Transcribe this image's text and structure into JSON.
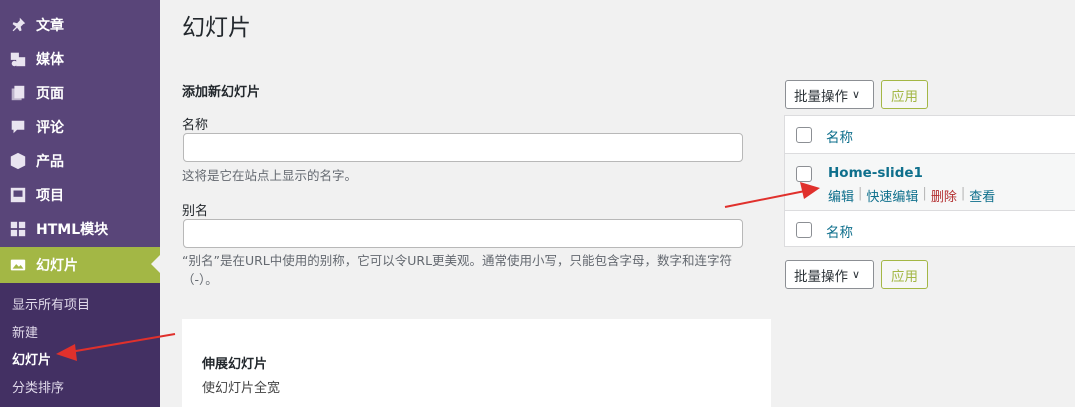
{
  "sidebar": {
    "items": [
      {
        "label": "文章",
        "icon": "pin-icon"
      },
      {
        "label": "媒体",
        "icon": "media-icon"
      },
      {
        "label": "页面",
        "icon": "pages-icon"
      },
      {
        "label": "评论",
        "icon": "comment-icon"
      },
      {
        "label": "产品",
        "icon": "cube-icon"
      },
      {
        "label": "项目",
        "icon": "portfolio-icon"
      },
      {
        "label": "HTML模块",
        "icon": "grid-icon"
      },
      {
        "label": "幻灯片",
        "icon": "slides-icon"
      }
    ],
    "submenu": [
      {
        "label": "显示所有项目"
      },
      {
        "label": "新建"
      },
      {
        "label": "幻灯片"
      },
      {
        "label": "分类排序"
      }
    ],
    "colors": {
      "background": "#594579",
      "active": "#a3b745",
      "submenu": "#433063"
    }
  },
  "page": {
    "title": "幻灯片"
  },
  "form": {
    "heading": "添加新幻灯片",
    "name_label": "名称",
    "name_value": "",
    "name_help": "这将是它在站点上显示的名字。",
    "slug_label": "别名",
    "slug_value": "",
    "slug_help": "“别名”是在URL中使用的别称，它可以令URL更美观。通常使用小写，只能包含字母，数字和连字符（-）。"
  },
  "extend": {
    "title": "伸展幻灯片",
    "desc": "使幻灯片全宽"
  },
  "list": {
    "bulk_label": "批量操作",
    "apply_label": "应用",
    "column_name": "名称",
    "rows": [
      {
        "title": "Home-slide1",
        "actions": {
          "edit": "编辑",
          "quick_edit": "快速编辑",
          "delete": "删除",
          "view": "查看"
        }
      }
    ],
    "colors": {
      "link": "#0e6f8c",
      "delete": "#b32d2e"
    }
  }
}
